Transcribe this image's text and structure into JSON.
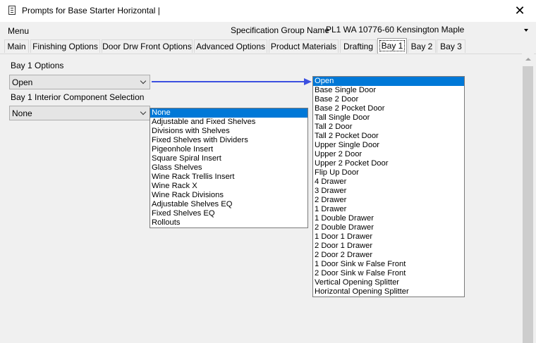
{
  "window": {
    "title": "Prompts for Base Starter Horizontal |",
    "close_glyph": "✕"
  },
  "menubar": {
    "menu_label": "Menu",
    "spec_group_label": "Specification Group Name",
    "spec_group_value": "PL1 WA 10776-60 Kensington Maple"
  },
  "tabs": [
    {
      "label": "Main"
    },
    {
      "label": "Finishing Options"
    },
    {
      "label": "Door Drw Front Options"
    },
    {
      "label": "Advanced Options"
    },
    {
      "label": "Product Materials"
    },
    {
      "label": "Drafting"
    },
    {
      "label": "Bay 1",
      "active": true
    },
    {
      "label": "Bay 2"
    },
    {
      "label": "Bay 3"
    }
  ],
  "bay1": {
    "options_label": "Bay 1 Options",
    "options_value": "Open",
    "interior_label": "Bay 1 Interior Component Selection",
    "interior_value": "None",
    "options_list": [
      "Open",
      "Base Single Door",
      "Base 2 Door",
      "Base 2 Pocket Door",
      "Tall Single Door",
      "Tall 2 Door",
      "Tall 2 Pocket Door",
      "Upper Single Door",
      "Upper 2 Door",
      "Upper 2 Pocket Door",
      "Flip Up Door",
      "4 Drawer",
      "3 Drawer",
      "2 Drawer",
      "1 Drawer",
      "1 Double Drawer",
      "2 Double Drawer",
      "1 Door 1 Drawer",
      "2 Door 1 Drawer",
      "2 Door 2 Drawer",
      "1 Door Sink w False Front",
      "2 Door Sink w False Front",
      "Vertical Opening Splitter",
      "Horizontal Opening Splitter"
    ],
    "interior_list": [
      "None",
      "Adjustable and Fixed Shelves",
      "Divisions with Shelves",
      "Fixed Shelves with Dividers",
      "Pigeonhole Insert",
      "Square Spiral Insert",
      "Glass Shelves",
      "Wine Rack Trellis Insert",
      "Wine Rack X",
      "Wine Rack Divisions",
      "Adjustable Shelves EQ",
      "Fixed Shelves EQ",
      "Rollouts"
    ]
  },
  "colors": {
    "selection": "#0078d7",
    "arrow": "#3c50e0"
  }
}
